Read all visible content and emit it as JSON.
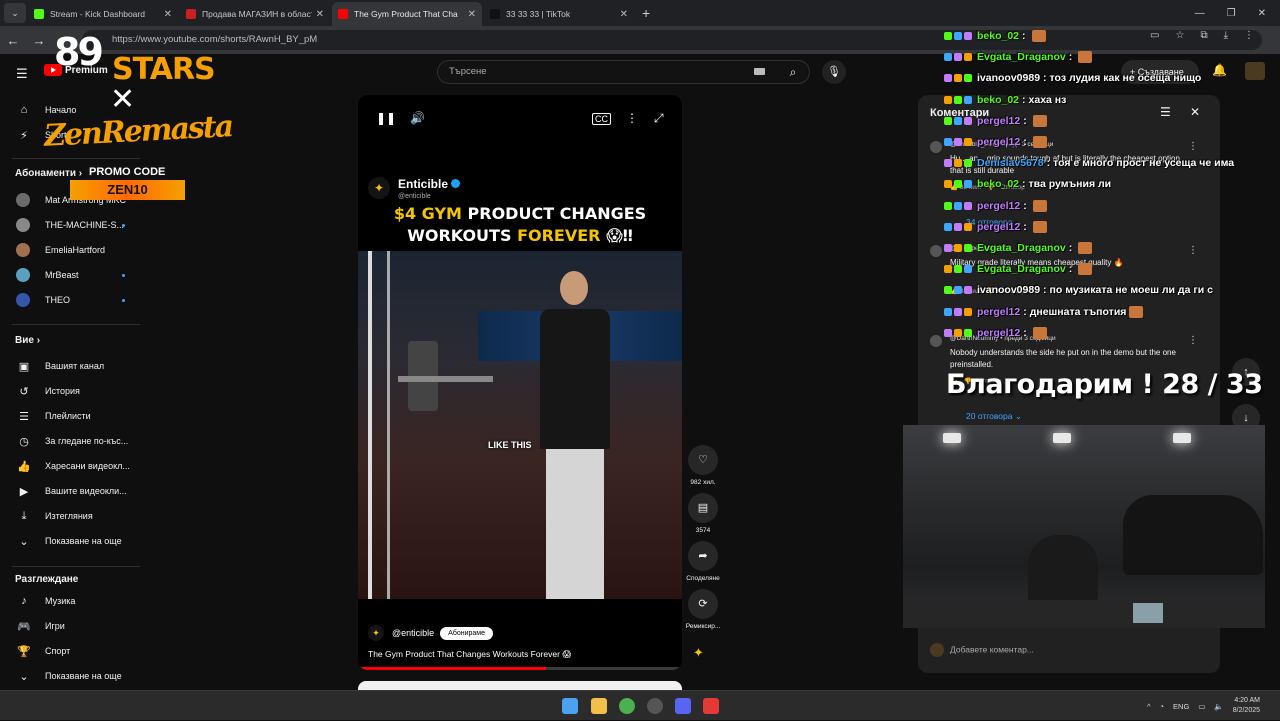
{
  "browser": {
    "tabs": [
      {
        "label": "Stream - Kick Dashboard",
        "color": "#53fc18",
        "active": false
      },
      {
        "label": "Продава МАГАЗИН в област С",
        "color": "#cc1f1f",
        "active": false
      },
      {
        "label": "The Gym Product That Cha",
        "color": "#ff0000",
        "active": true
      },
      {
        "label": "33 33 33 | TikTok",
        "color": "#111111",
        "active": false
      }
    ],
    "url": "https://www.youtube.com/shorts/RAwnH_BY_pM"
  },
  "overlay": {
    "brand_num": "89",
    "brand_word": "STARS",
    "cross": "✕",
    "partner": "ZenRemasta",
    "promo_label": "PROMO CODE",
    "promo_code": "ZEN10"
  },
  "youtube": {
    "logo_text": "Premium",
    "search_placeholder": "Търсене",
    "create_label": "+ Създаване",
    "nav": [
      {
        "label": "Начало",
        "icon": "⌂"
      },
      {
        "label": "Shorts",
        "icon": "⚡"
      }
    ],
    "subs_heading": "Абонаменти ›",
    "subscriptions": [
      {
        "label": "Mat Armstrong MKC",
        "color": "#6b6b6b",
        "live": false
      },
      {
        "label": "THE-MACHINE-S...",
        "color": "#888888",
        "live": true
      },
      {
        "label": "EmeliaHartford",
        "color": "#a07050",
        "live": false
      },
      {
        "label": "MrBeast",
        "color": "#5aa0c0",
        "live": true
      },
      {
        "label": "THEO",
        "color": "#3355aa",
        "live": true
      }
    ],
    "you_heading": "Вие ›",
    "you_items": [
      {
        "label": "Вашият канал",
        "icon": "▣"
      },
      {
        "label": "История",
        "icon": "↺"
      },
      {
        "label": "Плейлисти",
        "icon": "☰"
      },
      {
        "label": "За гледане по-къс...",
        "icon": "◷"
      },
      {
        "label": "Харесани видеокл...",
        "icon": "👍"
      },
      {
        "label": "Вашите видеокли...",
        "icon": "▶"
      },
      {
        "label": "Изтегляния",
        "icon": "⤓"
      },
      {
        "label": "Показване на още",
        "icon": "⌄"
      }
    ],
    "explore_heading": "Разглеждане",
    "explore_items": [
      {
        "label": "Музика",
        "icon": "♪"
      },
      {
        "label": "Игри",
        "icon": "🎮"
      },
      {
        "label": "Спорт",
        "icon": "🏆"
      },
      {
        "label": "Показване на още",
        "icon": "⌄"
      }
    ]
  },
  "short": {
    "channel": "Enticible",
    "handle": "@enticible",
    "headline_1a": "$4 GYM",
    "headline_1b": "PRODUCT CHANGES",
    "headline_2a": "WORKOUTS",
    "headline_2b": "FOREVER",
    "headline_emoji": "😱‼",
    "caption": "LIKE THIS",
    "footer_channel": "@enticible",
    "subscribe": "Абонираме",
    "title": "The Gym Product That Changes Workouts Forever 😱",
    "progress": 0.58,
    "actions": [
      {
        "icon": "♡",
        "label": "982 хил.",
        "name": "like"
      },
      {
        "icon": "▤",
        "label": "3574",
        "name": "comments"
      },
      {
        "icon": "➦",
        "label": "Споделяне",
        "name": "share"
      },
      {
        "icon": "⟳",
        "label": "Ремиксир...",
        "name": "remix"
      }
    ]
  },
  "comments_panel": {
    "title": "Коментари",
    "items": [
      {
        "author": "@enticible_stuff • преди 3 седмици",
        "text": "Hu... an... grip sounds tough af but is literally the cheapest option that is still durable",
        "likes": "38 хил.",
        "reply": "Отговор",
        "replies": "34 отговора ⌄"
      },
      {
        "author": "@... • преди 1 месец",
        "text": "Military grade literally means cheapest quality 🔥",
        "likes": "84 хил.",
        "reply": "Отговор",
        "replies": ""
      },
      {
        "author": "@DarthNeummy • преди 3 седмици",
        "text": "Nobody understands the side he put on in the demo but the one preinstalled.",
        "likes": "",
        "reply": "Отговор",
        "replies": "20 отговора ⌄"
      }
    ],
    "add_placeholder": "Добавете коментар..."
  },
  "chat": [
    {
      "user": "beko_02",
      "color": "#53fc18",
      "msg": "",
      "emote": true
    },
    {
      "user": "Evgata_Draganov",
      "color": "#53fc18",
      "msg": "",
      "emote": true
    },
    {
      "user": "ivanoov0989",
      "color": "#ffffff",
      "msg": "тоз лудия как не осеща нищо",
      "emote": false
    },
    {
      "user": "beko_02",
      "color": "#53fc18",
      "msg": "хаха нз",
      "emote": false
    },
    {
      "user": "pergel12",
      "color": "#c07bff",
      "msg": "",
      "emote": true
    },
    {
      "user": "pergel12",
      "color": "#c07bff",
      "msg": "",
      "emote": true
    },
    {
      "user": "Denislav5678",
      "color": "#3ea6ff",
      "msg": "тоя е много прост не усеща че има",
      "emote": false
    },
    {
      "user": "beko_02",
      "color": "#53fc18",
      "msg": "тва румъния ли",
      "emote": false
    },
    {
      "user": "pergel12",
      "color": "#c07bff",
      "msg": "",
      "emote": true
    },
    {
      "user": "pergel12",
      "color": "#c07bff",
      "msg": "",
      "emote": true
    },
    {
      "user": "Evgata_Draganov",
      "color": "#53fc18",
      "msg": "",
      "emote": true
    },
    {
      "user": "Evgata_Draganov",
      "color": "#53fc18",
      "msg": "",
      "emote": true
    },
    {
      "user": "ivanoov0989",
      "color": "#ffffff",
      "msg": "по музиката не моеш ли да ги с",
      "emote": false
    },
    {
      "user": "pergel12",
      "color": "#c07bff",
      "msg": "днешната тъпотия",
      "emote": true
    },
    {
      "user": "pergel12",
      "color": "#c07bff",
      "msg": "",
      "emote": true
    }
  ],
  "thanks_text": "Благодарим ! 28 / 33",
  "system": {
    "lang": "ENG",
    "time": "4:20 AM",
    "date": "8/2/2025"
  }
}
